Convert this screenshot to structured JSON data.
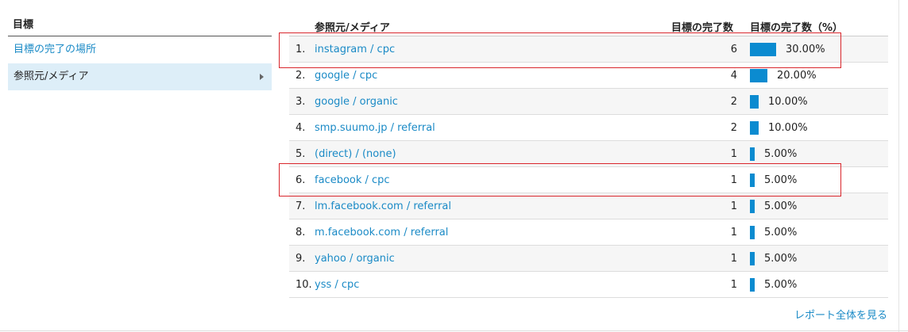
{
  "left_panel": {
    "header": "目標",
    "items": [
      {
        "label": "目標の完了の場所"
      },
      {
        "label": "参照元/メディア"
      }
    ]
  },
  "table": {
    "headers": {
      "source": "参照元/メディア",
      "count": "目標の完了数",
      "percent": "目標の完了数（%）"
    },
    "rows": [
      {
        "index": "1.",
        "source": "instagram / cpc",
        "count": "6",
        "percent": "30.00%",
        "share": 0.3
      },
      {
        "index": "2.",
        "source": "google / cpc",
        "count": "4",
        "percent": "20.00%",
        "share": 0.2
      },
      {
        "index": "3.",
        "source": "google / organic",
        "count": "2",
        "percent": "10.00%",
        "share": 0.1
      },
      {
        "index": "4.",
        "source": "smp.suumo.jp / referral",
        "count": "2",
        "percent": "10.00%",
        "share": 0.1
      },
      {
        "index": "5.",
        "source": "(direct) / (none)",
        "count": "1",
        "percent": "5.00%",
        "share": 0.05
      },
      {
        "index": "6.",
        "source": "facebook / cpc",
        "count": "1",
        "percent": "5.00%",
        "share": 0.05
      },
      {
        "index": "7.",
        "source": "lm.facebook.com / referral",
        "count": "1",
        "percent": "5.00%",
        "share": 0.05
      },
      {
        "index": "8.",
        "source": "m.facebook.com / referral",
        "count": "1",
        "percent": "5.00%",
        "share": 0.05
      },
      {
        "index": "9.",
        "source": "yahoo / organic",
        "count": "1",
        "percent": "5.00%",
        "share": 0.05
      },
      {
        "index": "10.",
        "source": "yss / cpc",
        "count": "1",
        "percent": "5.00%",
        "share": 0.05
      }
    ],
    "bar_color": "#0b8bd0"
  },
  "footer": {
    "full_report_link": "レポート全体を見る"
  },
  "colors": {
    "link": "#1a8ac6",
    "highlight_border": "#d9262c",
    "selected_bg": "#ddeef8"
  }
}
